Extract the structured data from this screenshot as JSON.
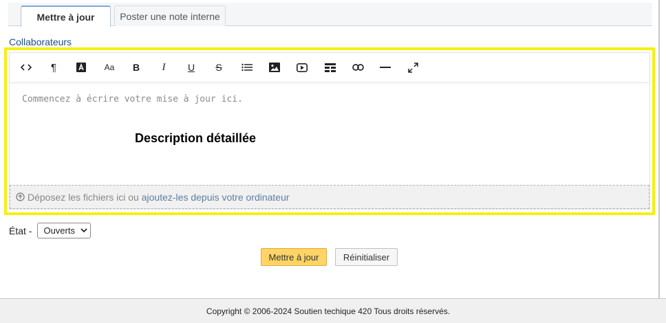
{
  "tabs": {
    "update_label": "Mettre à jour",
    "internal_note_label": "Poster une note interne"
  },
  "collaborators_link": "Collaborateurs",
  "editor": {
    "toolbar": [
      "code-view-icon",
      "paragraph-icon",
      "text-color-icon",
      "font-size-icon",
      "bold-icon",
      "italic-icon",
      "underline-icon",
      "strikethrough-icon",
      "bullet-list-icon",
      "image-icon",
      "video-icon",
      "table-icon",
      "link-icon",
      "horizontal-rule-icon",
      "fullscreen-icon"
    ],
    "toolbar_glyphs": {
      "paragraph": "¶",
      "font_size": "Aa",
      "bold": "B",
      "italic": "I",
      "underline": "U",
      "strike": "S"
    },
    "placeholder": "Commencez à écrire votre mise à jour ici.",
    "overlay_label": "Description détaillée",
    "dropzone_text": "Déposez les fichiers ici ou ",
    "dropzone_link": "ajoutez-les depuis votre ordinateur"
  },
  "state": {
    "label": "État -",
    "selected": "Ouverts"
  },
  "buttons": {
    "update": "Mettre à jour",
    "reset": "Réinitialiser"
  },
  "footer": {
    "copyright": "Copyright © 2006-2024 Soutien techique 420 Tous droits réservés."
  },
  "colors": {
    "highlight": "#f7ef12",
    "primary_button": "#ffd466",
    "link": "#1a4e8a"
  }
}
